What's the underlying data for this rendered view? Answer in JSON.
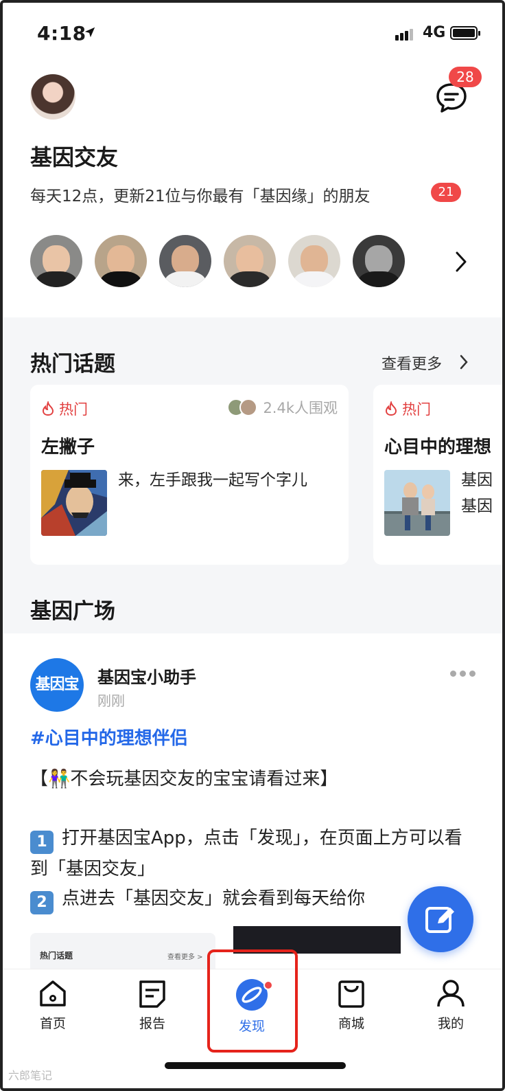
{
  "status_bar": {
    "time": "4:18",
    "network": "4G"
  },
  "header": {
    "message_badge": "28"
  },
  "section_friends": {
    "title": "基因交友",
    "subtitle": "每天12点，更新21位与你最有「基因缘」的朋友",
    "new_count": "21"
  },
  "hot_topics": {
    "title": "热门话题",
    "more": "查看更多",
    "cards": [
      {
        "tag": "热门",
        "watchers": "2.4k人围观",
        "title": "左撇子",
        "desc": "来，左手跟我一起写个字儿"
      },
      {
        "tag": "热门",
        "watchers": "",
        "title": "心目中的理想",
        "desc": "基因\n基因"
      }
    ]
  },
  "gene_square": {
    "title": "基因广场",
    "post": {
      "avatar_text": "基因宝",
      "author": "基因宝小助手",
      "time": "刚刚",
      "hashtag": "#心目中的理想伴侣",
      "line1": "【👫不会玩基因交友的宝宝请看过来】",
      "step1_num": "1",
      "step1": "打开基因宝App，点击「发现」，在页面上方可以看到「基因交友」",
      "step2_num": "2",
      "step2": "点进去「基因交友」就会看到每天给你",
      "preview_title": "热门话题",
      "preview_more": "查看更多 >"
    }
  },
  "tabbar": {
    "items": [
      {
        "label": "首页",
        "icon": "home-icon"
      },
      {
        "label": "报告",
        "icon": "report-icon"
      },
      {
        "label": "发现",
        "icon": "discover-icon"
      },
      {
        "label": "商城",
        "icon": "shop-bag-icon"
      },
      {
        "label": "我的",
        "icon": "profile-icon"
      }
    ],
    "active": "发现"
  },
  "watermark": "六郎笔记",
  "colors": {
    "accent": "#2f6fe8",
    "badge": "#f04848",
    "highlight": "#e5231b",
    "hashtag": "#2468e8"
  }
}
